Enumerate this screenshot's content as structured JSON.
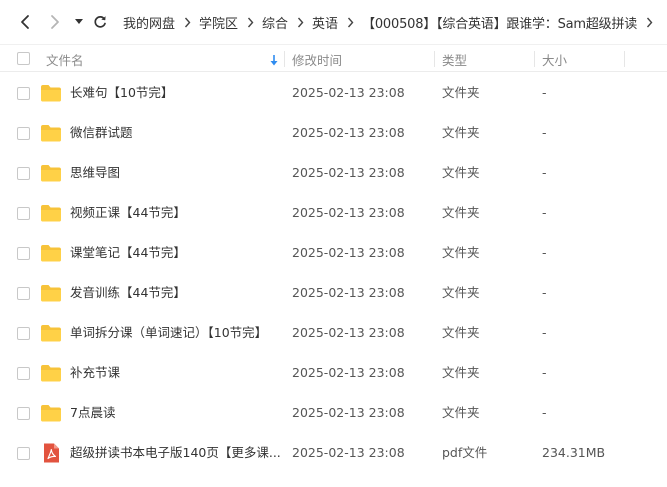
{
  "breadcrumbs": [
    "我的网盘",
    "学院区",
    "综合",
    "英语",
    "【000508】【综合英语】跟谁学：Sam超级拼读"
  ],
  "columns": {
    "name": "文件名",
    "modified": "修改时间",
    "type": "类型",
    "size": "大小"
  },
  "files": [
    {
      "name": "长难句【10节完】",
      "modified": "2025-02-13 23:08",
      "type": "文件夹",
      "size": "-",
      "icon": "folder-icon"
    },
    {
      "name": "微信群试题",
      "modified": "2025-02-13 23:08",
      "type": "文件夹",
      "size": "-",
      "icon": "folder-icon"
    },
    {
      "name": "思维导图",
      "modified": "2025-02-13 23:08",
      "type": "文件夹",
      "size": "-",
      "icon": "folder-icon"
    },
    {
      "name": "视频正课【44节完】",
      "modified": "2025-02-13 23:08",
      "type": "文件夹",
      "size": "-",
      "icon": "folder-icon"
    },
    {
      "name": "课堂笔记【44节完】",
      "modified": "2025-02-13 23:08",
      "type": "文件夹",
      "size": "-",
      "icon": "folder-icon"
    },
    {
      "name": "发音训练【44节完】",
      "modified": "2025-02-13 23:08",
      "type": "文件夹",
      "size": "-",
      "icon": "folder-icon"
    },
    {
      "name": "单词拆分课（单词速记）【10节完】",
      "modified": "2025-02-13 23:08",
      "type": "文件夹",
      "size": "-",
      "icon": "folder-icon"
    },
    {
      "name": "补充节课",
      "modified": "2025-02-13 23:08",
      "type": "文件夹",
      "size": "-",
      "icon": "folder-icon"
    },
    {
      "name": "7点晨读",
      "modified": "2025-02-13 23:08",
      "type": "文件夹",
      "size": "-",
      "icon": "folder-icon"
    },
    {
      "name": "超级拼读书本电子版140页【更多课...",
      "modified": "2025-02-13 23:08",
      "type": "pdf文件",
      "size": "234.31MB",
      "icon": "pdf-icon"
    }
  ],
  "colors": {
    "folder": "#F7C33A",
    "pdf": "#E2533F",
    "sort_arrow": "#2F8CF0"
  }
}
